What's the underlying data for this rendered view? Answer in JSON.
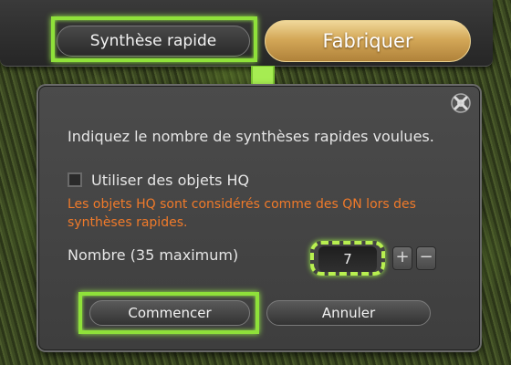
{
  "top_bar": {
    "quick_synthesis_label": "Synthèse rapide",
    "craft_label": "Fabriquer"
  },
  "dialog": {
    "prompt": "Indiquez le nombre de synthèses rapides voulues.",
    "hq_checkbox": {
      "label": "Utiliser des objets HQ",
      "checked": false
    },
    "hq_warning": "Les objets HQ sont considérés comme des QN lors des synthèses rapides.",
    "quantity": {
      "label": "Nombre (35 maximum)",
      "value": "7",
      "increment_symbol": "+",
      "decrement_symbol": "−"
    },
    "start_label": "Commencer",
    "cancel_label": "Annuler"
  },
  "colors": {
    "highlight": "#8fe13a",
    "warning_text": "#f07a2a",
    "craft_gold": "#d4a858"
  },
  "icons": {
    "close": "close-icon",
    "arrow": "arrow-down-icon"
  }
}
